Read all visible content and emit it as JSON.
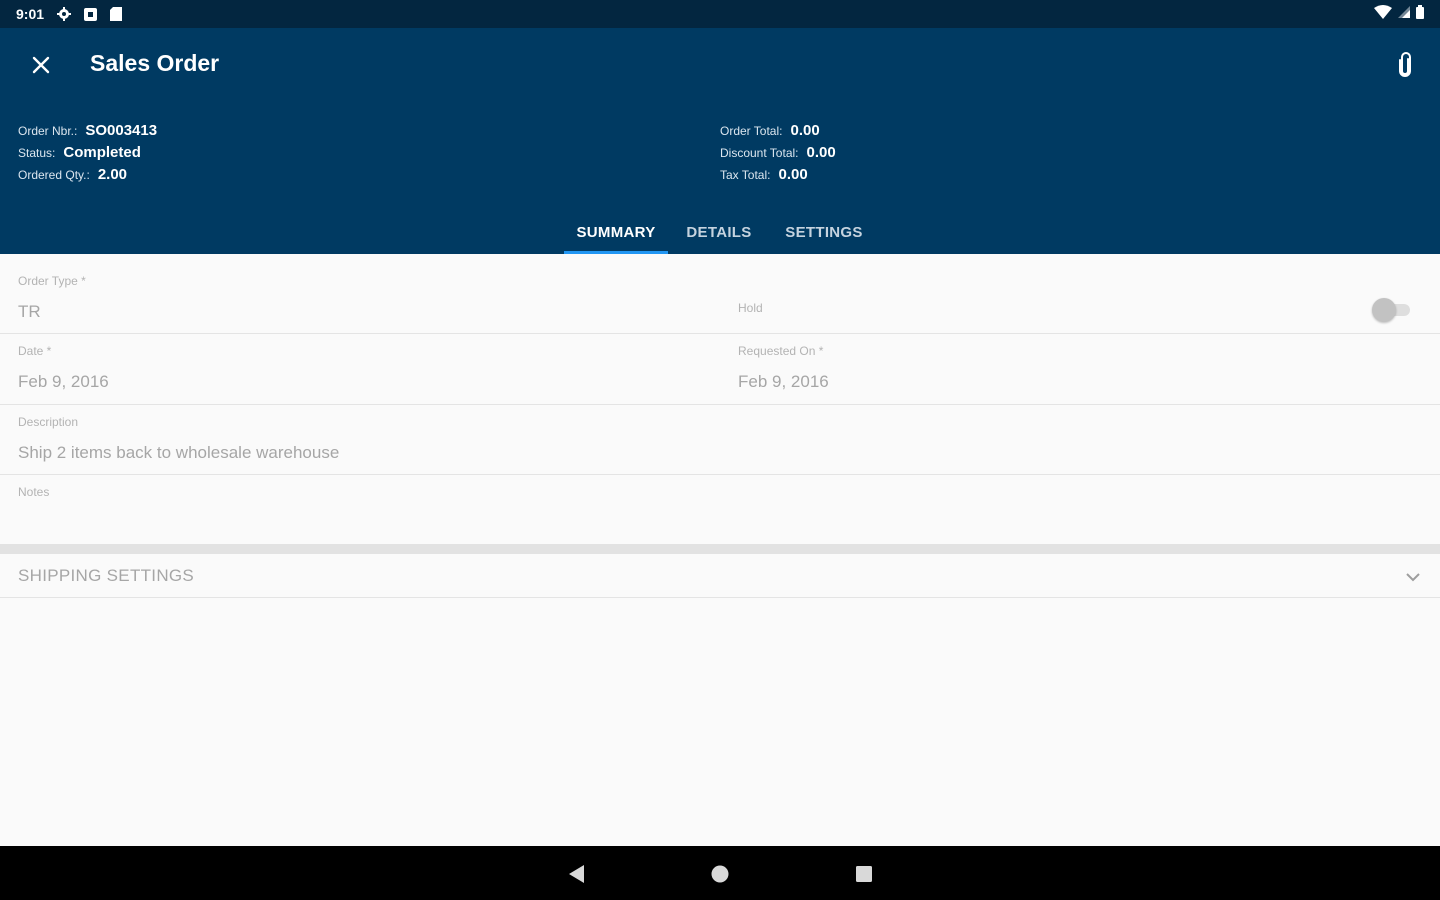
{
  "status_bar": {
    "time": "9:01",
    "left_icons": [
      "gear-icon",
      "notification-icon",
      "sd-card-icon"
    ],
    "right_icons": [
      "wifi-icon",
      "cell-signal-icon",
      "battery-icon"
    ]
  },
  "app_bar": {
    "title": "Sales Order",
    "close_icon": "close-icon",
    "attach_icon": "paperclip-icon",
    "background_color": "#003a62"
  },
  "order_info": {
    "left": [
      {
        "label": "Order Nbr.:",
        "value": "SO003413"
      },
      {
        "label": "Status:",
        "value": "Completed"
      },
      {
        "label": "Ordered Qty.:",
        "value": "2.00"
      }
    ],
    "right": [
      {
        "label": "Order Total:",
        "value": "0.00"
      },
      {
        "label": "Discount Total:",
        "value": "0.00"
      },
      {
        "label": "Tax Total:",
        "value": "0.00"
      }
    ]
  },
  "tabs": [
    {
      "label": "SUMMARY",
      "active": true
    },
    {
      "label": "DETAILS",
      "active": false
    },
    {
      "label": "SETTINGS",
      "active": false
    }
  ],
  "accent_color": "#2196f3",
  "form": {
    "order_type": {
      "label": "Order Type *",
      "value": "TR"
    },
    "hold": {
      "label": "Hold",
      "checked": false
    },
    "date": {
      "label": "Date *",
      "value": "Feb 9, 2016"
    },
    "requested_on": {
      "label": "Requested On *",
      "value": "Feb 9, 2016"
    },
    "description": {
      "label": "Description",
      "value": "Ship 2 items back to wholesale warehouse"
    },
    "notes": {
      "label": "Notes",
      "value": ""
    }
  },
  "shipping_section": {
    "title": "SHIPPING SETTINGS",
    "expanded": false,
    "icon": "chevron-down-icon"
  },
  "nav_bar": {
    "buttons": [
      "back-icon",
      "home-icon",
      "recents-icon"
    ]
  }
}
